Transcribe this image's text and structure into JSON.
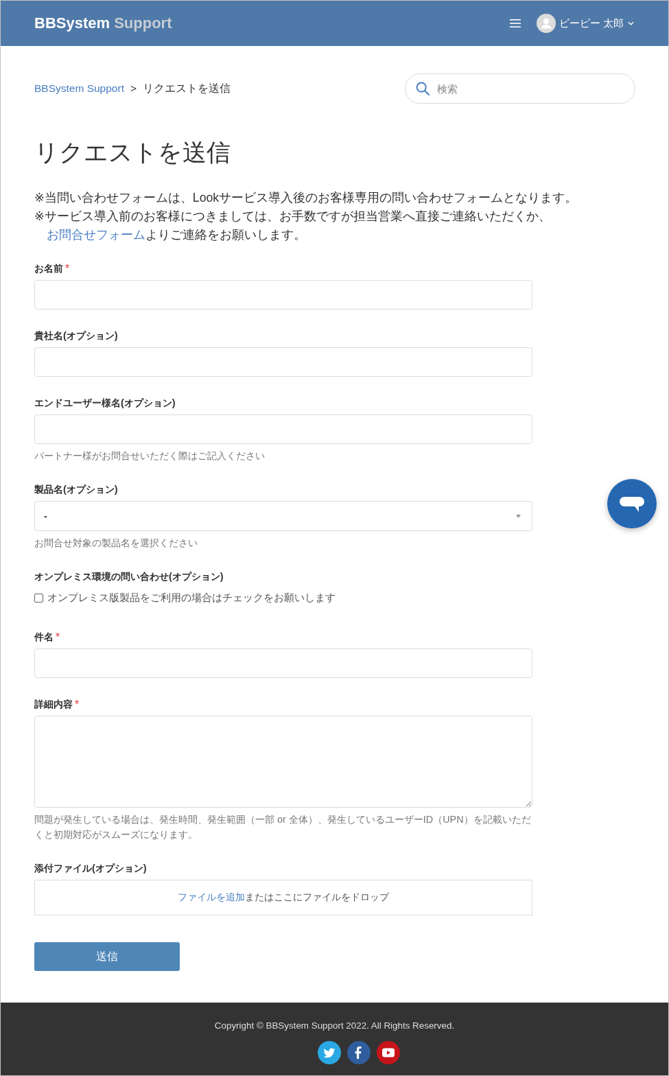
{
  "header": {
    "logo": {
      "primary": "BBSystem",
      "secondary": "Support"
    },
    "user": {
      "name": "ビーピー 太郎"
    }
  },
  "breadcrumb": {
    "items": [
      {
        "label": "BBSystem Support",
        "kind": "link"
      },
      {
        "label": "リクエストを送信",
        "kind": "current"
      }
    ],
    "separator": ">"
  },
  "search": {
    "placeholder": "検索"
  },
  "page_title": "リクエストを送信",
  "notices": [
    {
      "text": "※当問い合わせフォームは、Lookサービス導入後のお客様専用の問い合わせフォームとなります。"
    },
    {
      "text": "※サービス導入前のお客様につきましては、お手数ですが担当営業へ直接ご連絡いただくか、",
      "link": "お問合せフォーム",
      "after": "よりご連絡をお願いします。"
    }
  ],
  "form": {
    "fields": [
      {
        "kind": "text",
        "label": "お名前",
        "required": true
      },
      {
        "kind": "text",
        "label": "貴社名(オプション)",
        "required": false
      },
      {
        "kind": "text",
        "label": "エンドユーザー様名(オプション)",
        "required": false,
        "hint": "パートナー様がお問合せいただく際はご記入ください"
      },
      {
        "kind": "select",
        "label": "製品名(オプション)",
        "required": false,
        "value": "-",
        "hint": "お問合せ対象の製品名を選択ください"
      },
      {
        "kind": "checkbox",
        "label": "オンプレミス環境の問い合わせ(オプション)",
        "required": false,
        "option": "オンプレミス版製品をご利用の場合はチェックをお願いします",
        "checked": false
      },
      {
        "kind": "text",
        "label": "件名",
        "required": true
      },
      {
        "kind": "textarea",
        "label": "詳細内容",
        "required": true,
        "hint": "問題が発生している場合は、発生時間、発生範囲（一部 or 全体）、発生しているユーザーID（UPN）を記載いただくと初期対応がスムーズになります。"
      },
      {
        "kind": "file",
        "label": "添付ファイル(オプション)",
        "required": false,
        "link": "ファイルを追加",
        "text": "またはここにファイルをドロップ"
      }
    ],
    "submit": "送信"
  },
  "footer": {
    "copyright": "Copyright © BBSystem Support 2022. All Rights Reserved."
  }
}
